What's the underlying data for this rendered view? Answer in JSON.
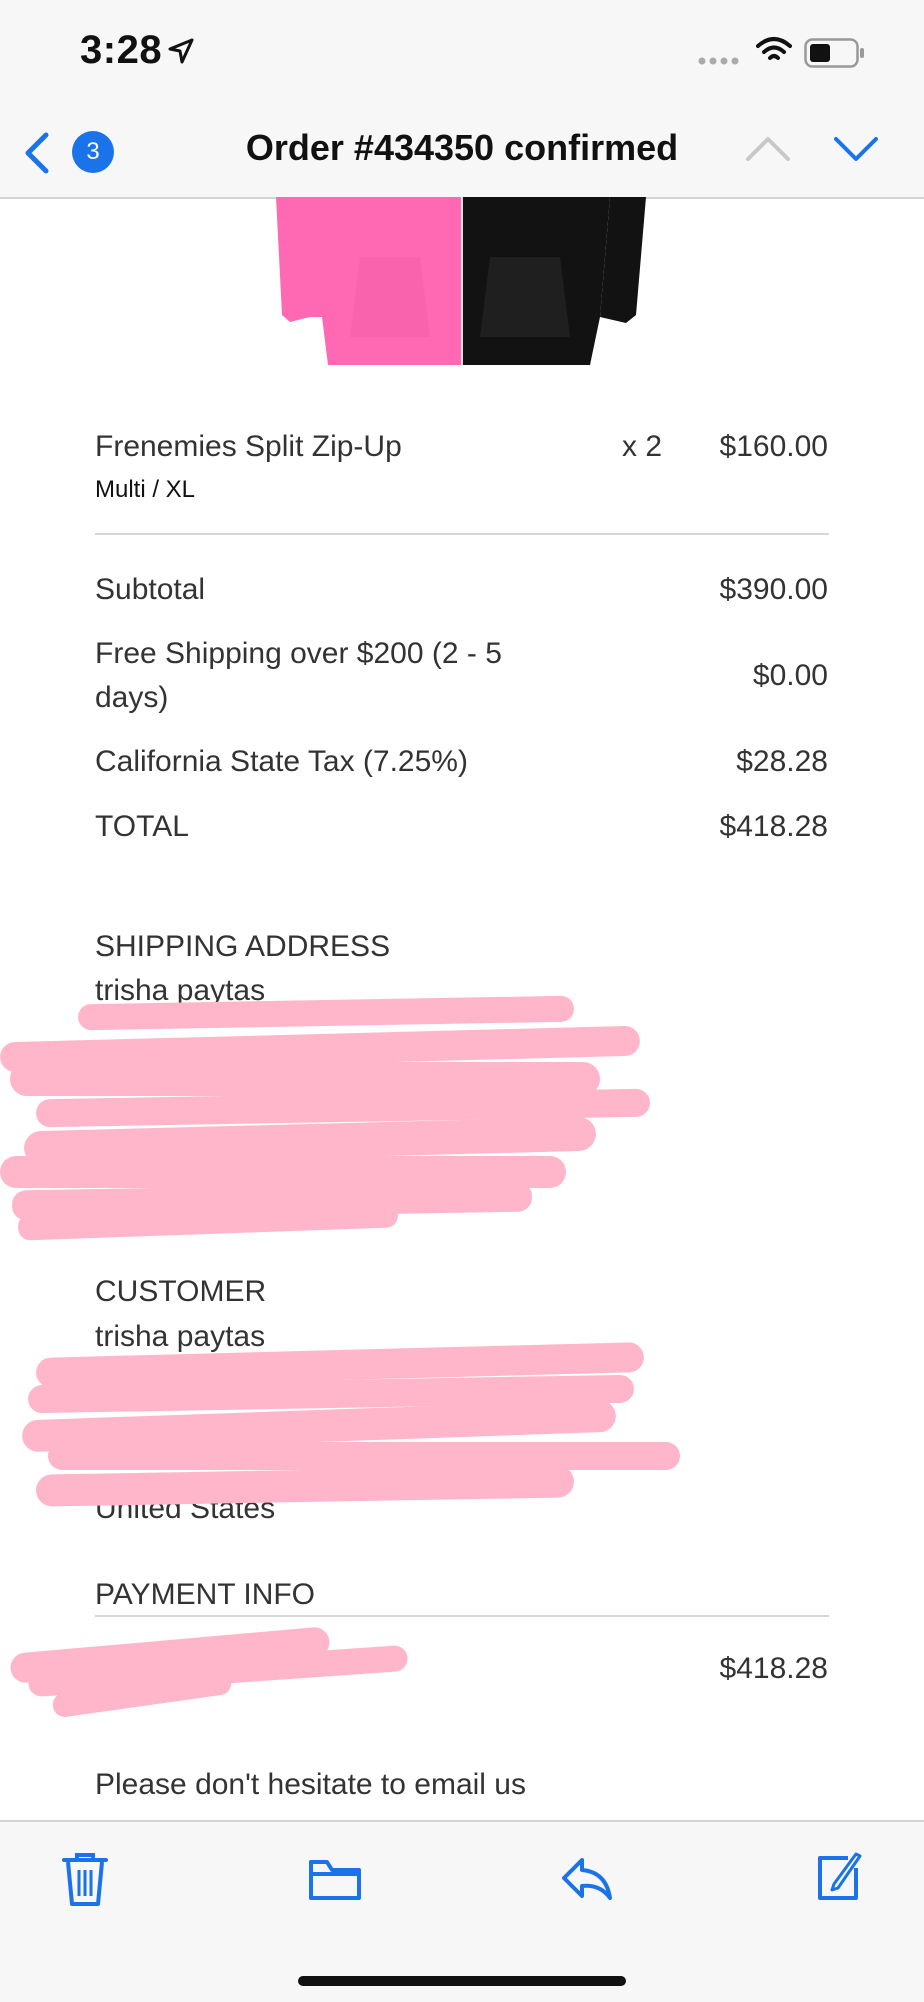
{
  "status": {
    "time": "3:28",
    "icons": [
      "location-arrow-icon",
      "signal-icon",
      "wifi-icon",
      "battery-icon"
    ]
  },
  "nav": {
    "back_icon": "chevron-left-icon",
    "unread_count": "3",
    "title": "Order #434350 confirmed",
    "prev_icon": "chevron-up-icon",
    "next_icon": "chevron-down-icon"
  },
  "product_image": {
    "icon": "hoodie-image",
    "colors": {
      "left": "#ff69b4",
      "right": "#111111"
    }
  },
  "line_item": {
    "name": "Frenemies Split Zip-Up",
    "variant": "Multi / XL",
    "quantity": "x 2",
    "price": "$160.00"
  },
  "totals": {
    "subtotal_label": "Subtotal",
    "subtotal_value": "$390.00",
    "shipping_label_1": "Free Shipping over $200 (2 - 5",
    "shipping_label_2": "days)",
    "shipping_value": "$0.00",
    "tax_label": "California State Tax (7.25%)",
    "tax_value": "$28.28",
    "total_label": "TOTAL",
    "total_value": "$418.28"
  },
  "shipping_address": {
    "heading": "SHIPPING ADDRESS",
    "name": "trisha paytas"
  },
  "customer": {
    "heading": "CUSTOMER",
    "name": "trisha paytas",
    "country": "United States"
  },
  "payment": {
    "heading": "PAYMENT INFO",
    "amount": "$418.28"
  },
  "footer_message": "Please don't hesitate to email us",
  "toolbar": {
    "icons": [
      "trash-icon",
      "folder-icon",
      "reply-icon",
      "compose-icon"
    ]
  },
  "colors": {
    "accent": "#1a73e8",
    "redaction": "#ffb6cb",
    "text": "#333333"
  }
}
